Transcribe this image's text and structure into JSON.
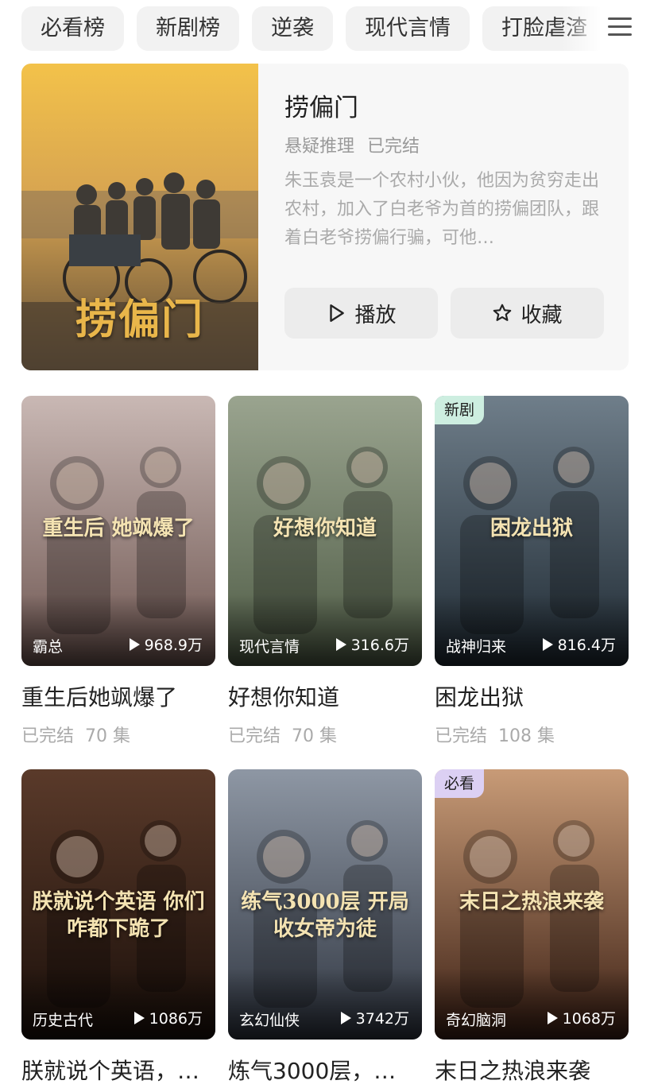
{
  "tabs": [
    "必看榜",
    "新剧榜",
    "逆袭",
    "现代言情",
    "打脸虐渣"
  ],
  "featured": {
    "title": "捞偏门",
    "poster_text": "捞偏门",
    "genre": "悬疑推理",
    "status": "已完结",
    "description": "朱玉袁是一个农村小伙，他因为贫穷走出农村，加入了白老爷为首的捞偏团队，跟着白老爷捞偏行骗，可他…",
    "play_label": "播放",
    "favorite_label": "收藏"
  },
  "cards": [
    {
      "title": "重生后她飒爆了",
      "genre": "霸总",
      "views": "968.9万",
      "status": "已完结",
      "episodes": "70 集",
      "badge": "",
      "poster_text": "重生后 她飒爆了",
      "colors": [
        "#c9b8b4",
        "#6d5550"
      ]
    },
    {
      "title": "好想你知道",
      "genre": "现代言情",
      "views": "316.6万",
      "status": "已完结",
      "episodes": "70 集",
      "badge": "",
      "poster_text": "好想你知道",
      "colors": [
        "#9aa48f",
        "#4e5b45"
      ]
    },
    {
      "title": "困龙出狱",
      "genre": "战神归来",
      "views": "816.4万",
      "status": "已完结",
      "episodes": "108 集",
      "badge": "新剧",
      "poster_text": "困龙出狱",
      "colors": [
        "#6f7e8a",
        "#1f2a33"
      ]
    },
    {
      "title": "朕就说个英语，…",
      "genre": "历史古代",
      "views": "1086万",
      "status": "",
      "episodes": "",
      "badge": "",
      "poster_text": "朕就说个英语 你们咋都下跪了",
      "colors": [
        "#5a3a2a",
        "#1a0f0a"
      ]
    },
    {
      "title": "炼气3000层，…",
      "genre": "玄幻仙侠",
      "views": "3742万",
      "status": "",
      "episodes": "",
      "badge": "",
      "poster_text": "练气3000层 开局收女帝为徒",
      "colors": [
        "#8e97a4",
        "#2f3540"
      ]
    },
    {
      "title": "末日之热浪来袭",
      "genre": "奇幻脑洞",
      "views": "1068万",
      "status": "",
      "episodes": "",
      "badge": "必看",
      "poster_text": "末日之热浪来袭",
      "colors": [
        "#c89b77",
        "#3b1f14"
      ]
    }
  ],
  "badge_colors": {
    "新剧": "#cdeee0",
    "必看": "#dcd0f3"
  }
}
